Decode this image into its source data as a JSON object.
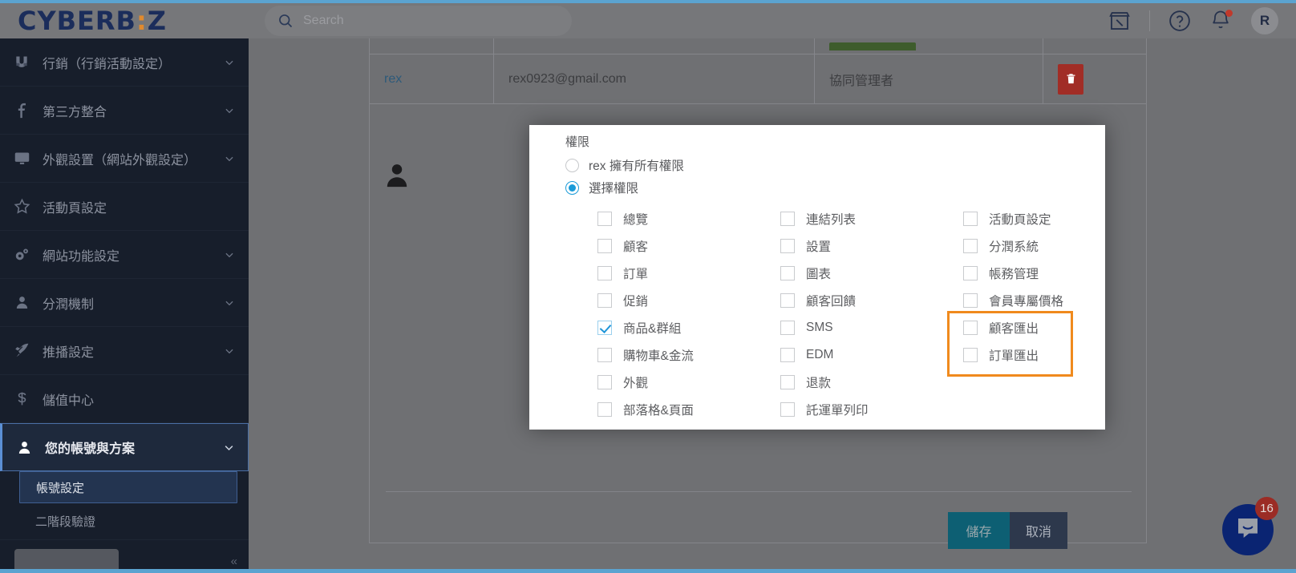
{
  "brand": {
    "logo_text": "CYBERB",
    "logo_dots": ":",
    "logo_tail": "Z",
    "accent_color": "#5ba3d0",
    "logo_color": "#1b2d5b",
    "logo_dot_color": "#e08a2e"
  },
  "header": {
    "search_placeholder": "Search",
    "search_value": "",
    "icons": [
      "store-icon",
      "help-circle-icon",
      "bell-icon"
    ],
    "avatar_initial": "R",
    "has_notification": true
  },
  "sidebar": {
    "items": [
      {
        "label": "行銷（行銷活動設定）",
        "icon": "magnet-icon",
        "expandable": true,
        "active": false
      },
      {
        "label": "第三方整合",
        "icon": "facebook-icon",
        "expandable": true,
        "active": false
      },
      {
        "label": "外觀設置（網站外觀設定）",
        "icon": "monitor-icon",
        "expandable": true,
        "active": false
      },
      {
        "label": "活動頁設定",
        "icon": "star-icon",
        "expandable": false,
        "active": false
      },
      {
        "label": "網站功能設定",
        "icon": "gears-icon",
        "expandable": true,
        "active": false
      },
      {
        "label": "分潤機制",
        "icon": "user-icon",
        "expandable": true,
        "active": false
      },
      {
        "label": "推播設定",
        "icon": "rocket-icon",
        "expandable": true,
        "active": false
      },
      {
        "label": "儲值中心",
        "icon": "dollar-icon",
        "expandable": false,
        "active": false
      },
      {
        "label": "您的帳號與方案",
        "icon": "user-icon",
        "expandable": true,
        "active": true
      }
    ],
    "subitems": [
      {
        "label": "帳號設定",
        "selected": true
      },
      {
        "label": "二階段驗證",
        "selected": false
      }
    ]
  },
  "table": {
    "rows": [
      {
        "name": "",
        "email": "",
        "role": "",
        "partial": true,
        "badge": true
      },
      {
        "name": "rex",
        "email": "rex0923@gmail.com",
        "role": "協同管理者",
        "partial": false,
        "delete_icon": "trash-icon"
      }
    ]
  },
  "modal": {
    "title": "權限",
    "person_icon": "person-icon",
    "radios": [
      {
        "label": "rex 擁有所有權限",
        "checked": false
      },
      {
        "label": "選擇權限",
        "checked": true
      }
    ],
    "columns": [
      {
        "items": [
          {
            "label": "總覽",
            "checked": false
          },
          {
            "label": "顧客",
            "checked": false
          },
          {
            "label": "訂單",
            "checked": false
          },
          {
            "label": "促銷",
            "checked": false
          },
          {
            "label": "商品&群組",
            "checked": true
          },
          {
            "label": "購物車&金流",
            "checked": false
          },
          {
            "label": "外觀",
            "checked": false
          },
          {
            "label": "部落格&頁面",
            "checked": false
          }
        ]
      },
      {
        "items": [
          {
            "label": "連結列表",
            "checked": false
          },
          {
            "label": "設置",
            "checked": false
          },
          {
            "label": "圖表",
            "checked": false
          },
          {
            "label": "顧客回饋",
            "checked": false
          },
          {
            "label": "SMS",
            "checked": false
          },
          {
            "label": "EDM",
            "checked": false
          },
          {
            "label": "退款",
            "checked": false
          },
          {
            "label": "託運單列印",
            "checked": false
          }
        ]
      },
      {
        "items": [
          {
            "label": "活動頁設定",
            "checked": false
          },
          {
            "label": "分潤系統",
            "checked": false
          },
          {
            "label": "帳務管理",
            "checked": false
          },
          {
            "label": "會員專屬價格",
            "checked": false
          },
          {
            "label": "顧客匯出",
            "checked": false,
            "highlighted": true
          },
          {
            "label": "訂單匯出",
            "checked": false,
            "highlighted": true
          }
        ]
      }
    ],
    "highlight_color": "#f08a1d"
  },
  "footer": {
    "save_label": "儲存",
    "cancel_label": "取消",
    "save_color": "#0d5f73",
    "cancel_color": "#2d384c"
  },
  "chat": {
    "icon": "chat-bubble-icon",
    "badge_count": "16",
    "bubble_color": "#0a2472",
    "badge_color": "#9b2c25"
  }
}
